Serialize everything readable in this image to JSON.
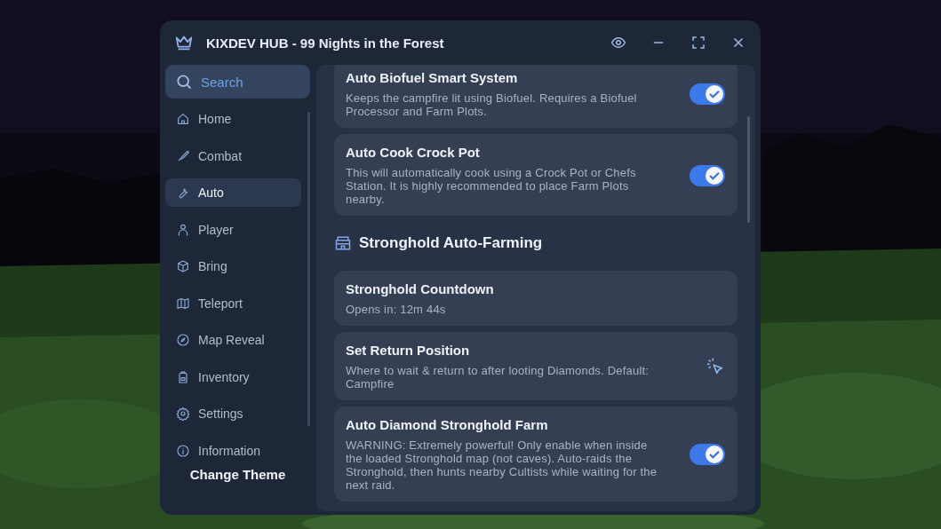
{
  "window": {
    "title": "KIXDEV HUB - 99 Nights in the Forest"
  },
  "sidebar": {
    "search": {
      "placeholder": "Search"
    },
    "items": [
      {
        "label": "Home",
        "selected": false
      },
      {
        "label": "Combat",
        "selected": false
      },
      {
        "label": "Auto",
        "selected": true
      },
      {
        "label": "Player",
        "selected": false
      },
      {
        "label": "Bring",
        "selected": false
      },
      {
        "label": "Teleport",
        "selected": false
      },
      {
        "label": "Map Reveal",
        "selected": false
      },
      {
        "label": "Inventory",
        "selected": false
      },
      {
        "label": "Settings",
        "selected": false
      },
      {
        "label": "Information",
        "selected": false
      }
    ],
    "footer_button": "Change Theme"
  },
  "content": {
    "items": [
      {
        "kind": "toggle",
        "title": "Auto Biofuel Smart System",
        "description": "Keeps the campfire lit using Biofuel. Requires a Biofuel Processor and Farm Plots.",
        "on": true
      },
      {
        "kind": "toggle",
        "title": "Auto Cook Crock Pot",
        "description": "This will automatically cook using a Crock Pot or Chefs Station. It is highly recommended to place Farm Plots nearby.",
        "on": true
      },
      {
        "kind": "section",
        "title": "Stronghold Auto-Farming"
      },
      {
        "kind": "info",
        "title": "Stronghold Countdown",
        "description": "Opens in:  12m  44s"
      },
      {
        "kind": "action",
        "title": "Set Return Position",
        "description": "Where to wait & return to after looting Diamonds. Default: Campfire"
      },
      {
        "kind": "toggle",
        "title": "Auto Diamond Stronghold Farm",
        "description": "WARNING: Extremely powerful! Only enable when inside the loaded Stronghold map (not caves). Auto-raids the Stronghold, then hunts nearby Cultists while waiting for the next raid.",
        "on": true
      }
    ]
  }
}
